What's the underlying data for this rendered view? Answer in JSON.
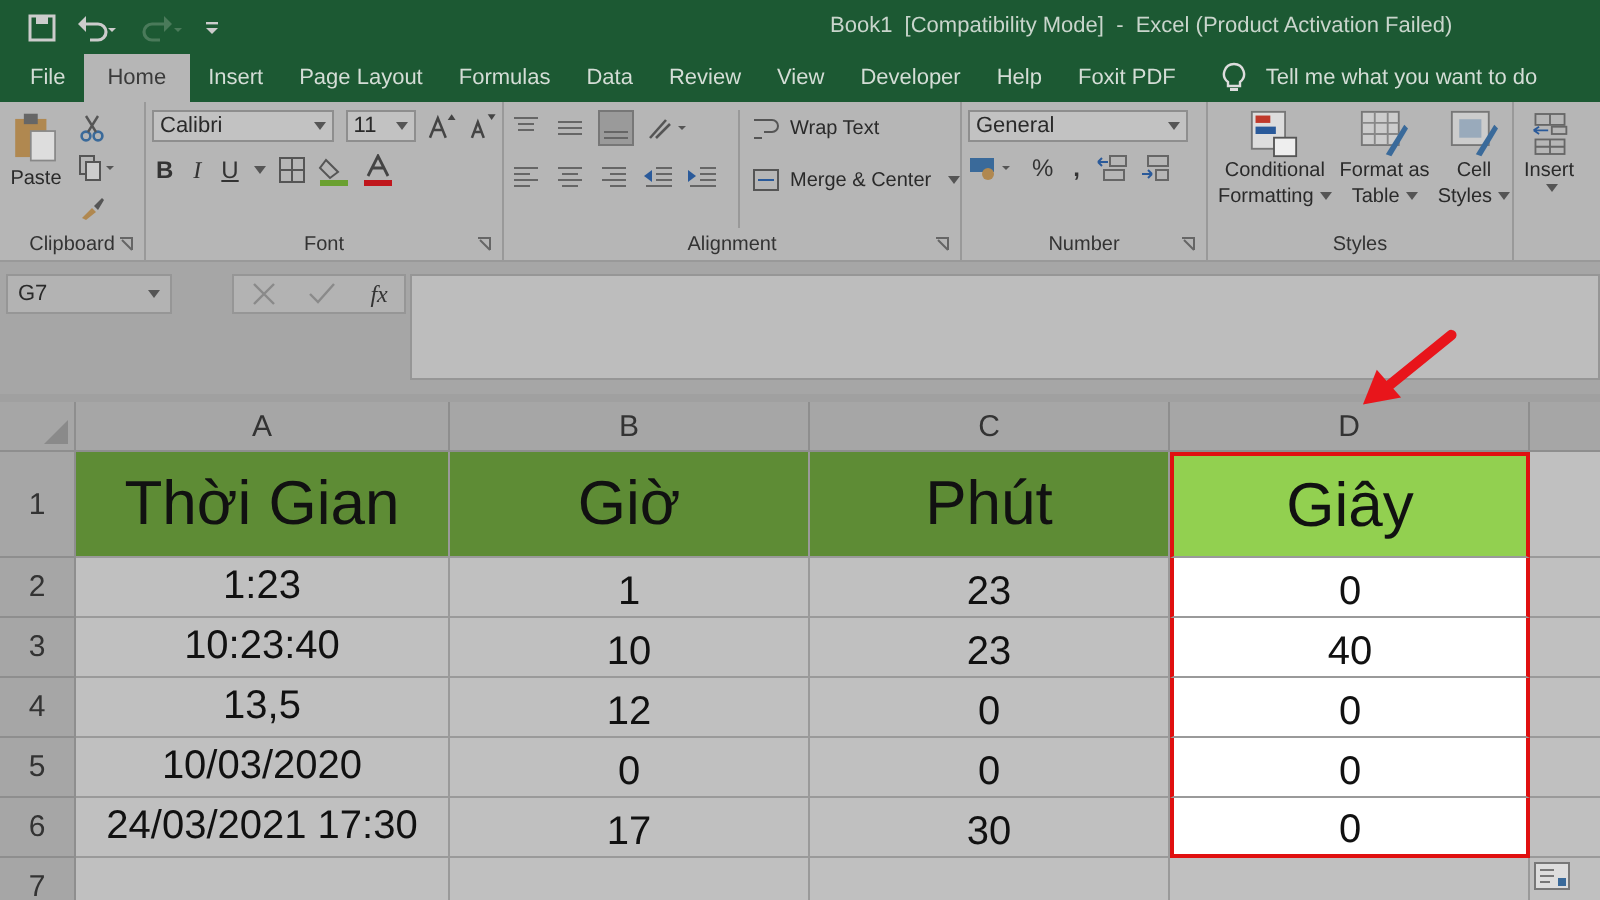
{
  "window": {
    "title": "Book1  [Compatibility Mode]  -  Excel (Product Activation Failed)"
  },
  "tabs": [
    {
      "label": "File",
      "selected": false
    },
    {
      "label": "Home",
      "selected": true
    },
    {
      "label": "Insert",
      "selected": false
    },
    {
      "label": "Page Layout",
      "selected": false
    },
    {
      "label": "Formulas",
      "selected": false
    },
    {
      "label": "Data",
      "selected": false
    },
    {
      "label": "Review",
      "selected": false
    },
    {
      "label": "View",
      "selected": false
    },
    {
      "label": "Developer",
      "selected": false
    },
    {
      "label": "Help",
      "selected": false
    },
    {
      "label": "Foxit PDF",
      "selected": false
    }
  ],
  "tell_me": "Tell me what you want to do",
  "ribbon": {
    "paste": "Paste",
    "font_name": "Calibri",
    "font_size": "11",
    "bold": "B",
    "italic": "I",
    "underline": "U",
    "wrap_text": "Wrap Text",
    "merge_center": "Merge & Center",
    "number_format": "General",
    "percent": "%",
    "comma": ",",
    "conditional_formatting": [
      "Conditional",
      "Formatting"
    ],
    "format_as_table": [
      "Format as",
      "Table"
    ],
    "cell_styles": [
      "Cell",
      "Styles"
    ],
    "insert": "Insert",
    "groups": [
      "Clipboard",
      "Font",
      "Alignment",
      "Number",
      "Styles"
    ]
  },
  "formula_bar": {
    "name_box": "G7",
    "fx": "fx"
  },
  "sheet": {
    "columns": [
      {
        "label": "A",
        "highlighted": false
      },
      {
        "label": "B",
        "highlighted": false
      },
      {
        "label": "C",
        "highlighted": false
      },
      {
        "label": "D",
        "highlighted": true
      }
    ],
    "header_row": {
      "number": "1",
      "cells": [
        "Thời Gian",
        "Giờ",
        "Phút",
        "Giây"
      ]
    },
    "rows": [
      {
        "number": "2",
        "cells": [
          "1:23",
          "1",
          "23",
          "0"
        ]
      },
      {
        "number": "3",
        "cells": [
          "10:23:40",
          "10",
          "23",
          "40"
        ]
      },
      {
        "number": "4",
        "cells": [
          "13,5",
          "12",
          "0",
          "0"
        ]
      },
      {
        "number": "5",
        "cells": [
          "10/03/2020",
          "0",
          "0",
          "0"
        ]
      },
      {
        "number": "6",
        "cells": [
          "24/03/2021 17:30",
          "17",
          "30",
          "0"
        ]
      }
    ],
    "empty_row": "7"
  }
}
